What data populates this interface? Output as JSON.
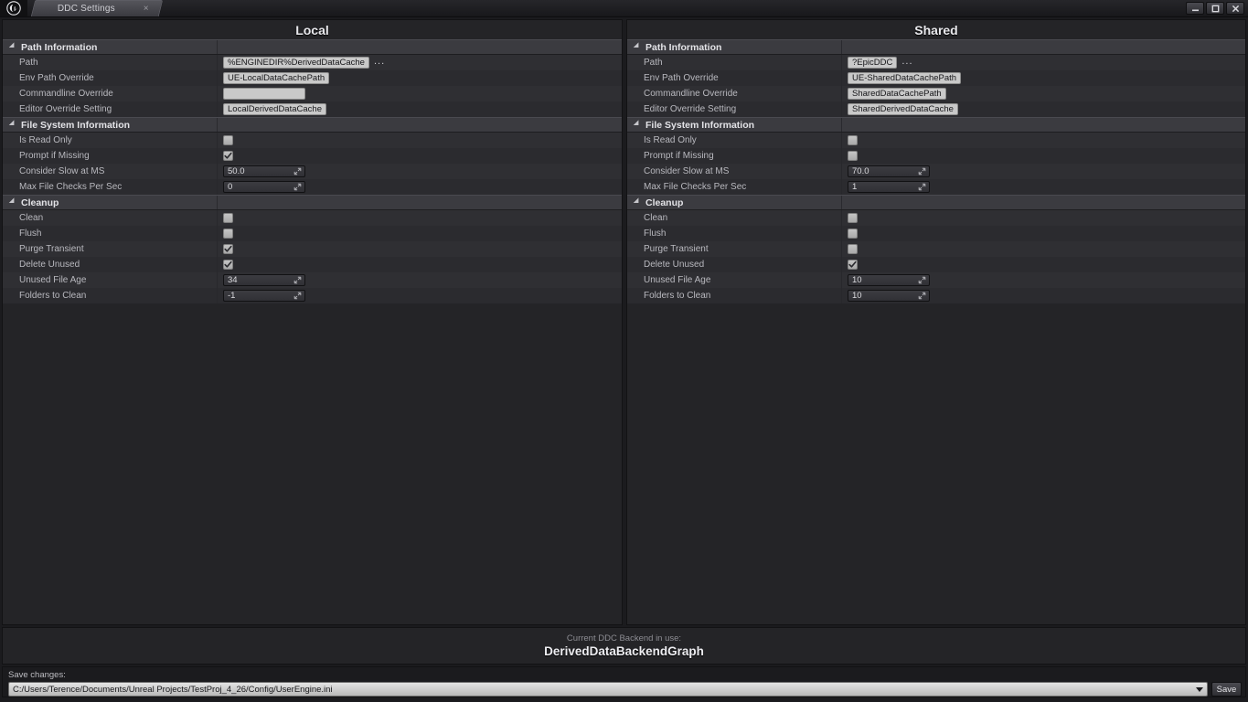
{
  "window": {
    "app_logo": "unreal-engine-logo",
    "tab_title": "DDC Settings",
    "tab_close": "×",
    "minimize": "minimize-icon",
    "maximize": "maximize-icon",
    "close": "close-icon"
  },
  "panels": [
    {
      "title": "Local",
      "sections": [
        {
          "label": "Path Information",
          "rows": [
            {
              "name": "Path",
              "type": "text",
              "value": "%ENGINEDIR%DerivedDataCache",
              "browse": "..."
            },
            {
              "name": "Env Path Override",
              "type": "text",
              "value": "UE-LocalDataCachePath"
            },
            {
              "name": "Commandline Override",
              "type": "text",
              "value": ""
            },
            {
              "name": "Editor Override Setting",
              "type": "text",
              "value": "LocalDerivedDataCache"
            }
          ]
        },
        {
          "label": "File System Information",
          "rows": [
            {
              "name": "Is Read Only",
              "type": "checkbox",
              "checked": false
            },
            {
              "name": "Prompt if Missing",
              "type": "checkbox",
              "checked": true
            },
            {
              "name": "Consider Slow at MS",
              "type": "spinner",
              "value": "50.0"
            },
            {
              "name": "Max File Checks Per Sec",
              "type": "spinner",
              "value": "0"
            }
          ]
        },
        {
          "label": "Cleanup",
          "rows": [
            {
              "name": "Clean",
              "type": "checkbox",
              "checked": false
            },
            {
              "name": "Flush",
              "type": "checkbox",
              "checked": false
            },
            {
              "name": "Purge Transient",
              "type": "checkbox",
              "checked": true
            },
            {
              "name": "Delete Unused",
              "type": "checkbox",
              "checked": true
            },
            {
              "name": "Unused File Age",
              "type": "spinner",
              "value": "34"
            },
            {
              "name": "Folders to Clean",
              "type": "spinner",
              "value": "-1"
            }
          ]
        }
      ]
    },
    {
      "title": "Shared",
      "sections": [
        {
          "label": "Path Information",
          "rows": [
            {
              "name": "Path",
              "type": "text",
              "value": "?EpicDDC",
              "browse": "..."
            },
            {
              "name": "Env Path Override",
              "type": "text",
              "value": "UE-SharedDataCachePath"
            },
            {
              "name": "Commandline Override",
              "type": "text",
              "value": "SharedDataCachePath"
            },
            {
              "name": "Editor Override Setting",
              "type": "text",
              "value": "SharedDerivedDataCache"
            }
          ]
        },
        {
          "label": "File System Information",
          "rows": [
            {
              "name": "Is Read Only",
              "type": "checkbox",
              "checked": false
            },
            {
              "name": "Prompt if Missing",
              "type": "checkbox",
              "checked": false
            },
            {
              "name": "Consider Slow at MS",
              "type": "spinner",
              "value": "70.0"
            },
            {
              "name": "Max File Checks Per Sec",
              "type": "spinner",
              "value": "1"
            }
          ]
        },
        {
          "label": "Cleanup",
          "rows": [
            {
              "name": "Clean",
              "type": "checkbox",
              "checked": false
            },
            {
              "name": "Flush",
              "type": "checkbox",
              "checked": false
            },
            {
              "name": "Purge Transient",
              "type": "checkbox",
              "checked": false
            },
            {
              "name": "Delete Unused",
              "type": "checkbox",
              "checked": true
            },
            {
              "name": "Unused File Age",
              "type": "spinner",
              "value": "10"
            },
            {
              "name": "Folders to Clean",
              "type": "spinner",
              "value": "10"
            }
          ]
        }
      ]
    }
  ],
  "backend": {
    "caption": "Current DDC Backend in use:",
    "name": "DerivedDataBackendGraph"
  },
  "save": {
    "label": "Save changes:",
    "path": "C:/Users/Terence/Documents/Unreal Projects/TestProj_4_26/Config/UserEngine.ini",
    "button": "Save"
  },
  "colors": {
    "pane_bg": "#242427",
    "row_bg": "#2f2f33",
    "section_bg": "#3b3b40",
    "field_light": "#c9c9c9"
  }
}
